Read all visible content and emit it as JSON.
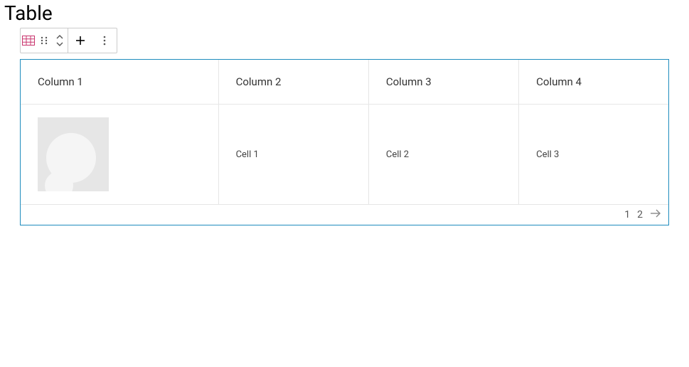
{
  "block": {
    "title": "Table",
    "toolbar": {
      "icon": "table-icon",
      "drag": "drag-handle-icon",
      "move": "move-up-down-icon",
      "add": "+",
      "more": "more-icon"
    }
  },
  "table": {
    "columns": [
      "Column 1",
      "Column 2",
      "Column 3",
      "Column 4"
    ],
    "rows": [
      {
        "cells": [
          "",
          "Cell 1",
          "Cell 2",
          "Cell 3"
        ],
        "firstCellType": "avatar"
      }
    ]
  },
  "pagination": {
    "pages": [
      "1",
      "2"
    ],
    "nextIcon": "arrow-right-icon"
  }
}
